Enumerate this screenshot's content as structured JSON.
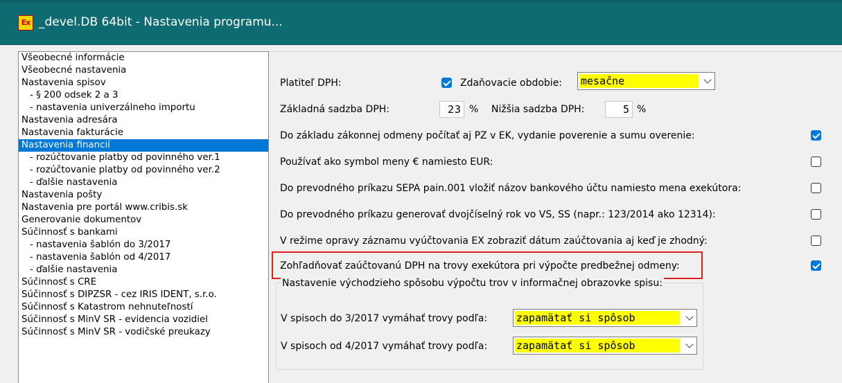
{
  "window": {
    "title": "_devel.DB 64bit - Nastavenia programu...",
    "icon": "app-ex-icon",
    "icon_text": "Ex"
  },
  "sidebar": {
    "items": [
      {
        "label": "Všeobecné informácie",
        "sub": false
      },
      {
        "label": "Všeobecné nastavenia",
        "sub": false
      },
      {
        "label": "Nastavenia spisov",
        "sub": false
      },
      {
        "label": "- § 200 odsek 2 a 3",
        "sub": true
      },
      {
        "label": "- nastavenia univerzálneho importu",
        "sub": true
      },
      {
        "label": "Nastavenia adresára",
        "sub": false
      },
      {
        "label": "Nastavenia fakturácie",
        "sub": false
      },
      {
        "label": "Nastavenia financií",
        "sub": false,
        "selected": true
      },
      {
        "label": "- rozúčtovanie platby od povinného ver.1",
        "sub": true
      },
      {
        "label": "- rozúčtovanie platby od povinného ver.2",
        "sub": true
      },
      {
        "label": "- ďalšie nastavenia",
        "sub": true
      },
      {
        "label": "Nastavenia pošty",
        "sub": false
      },
      {
        "label": "Nastavenia pre portál www.cribis.sk",
        "sub": false
      },
      {
        "label": "Generovanie dokumentov",
        "sub": false
      },
      {
        "label": "Súčinnosť s bankami",
        "sub": false
      },
      {
        "label": "- nastavenia šablón do 3/2017",
        "sub": true
      },
      {
        "label": "- nastavenia šablón od 4/2017",
        "sub": true
      },
      {
        "label": "- ďalšie nastavenia",
        "sub": true
      },
      {
        "label": "Súčinnosť s CRE",
        "sub": false
      },
      {
        "label": "Súčinnosť s DIPZSR - cez IRIS IDENT, s.r.o.",
        "sub": false
      },
      {
        "label": "Súčinnosť s Katastrom nehnuteľností",
        "sub": false
      },
      {
        "label": "Súčinnosť s MinV SR - evidencia vozidiel",
        "sub": false
      },
      {
        "label": "Súčinnosť s MinV SR - vodičské preukazy",
        "sub": false
      }
    ]
  },
  "settings": {
    "platitel_dph_label": "Platiteľ DPH:",
    "platitel_dph_checked": true,
    "zdanovacie_label": "Zdaňovacie obdobie:",
    "zdanovacie_value": "mesačne",
    "zakladna_label": "Základná sadzba DPH:",
    "zakladna_value": "23",
    "percent_symbol": "%",
    "nizsia_label": "Nižšia sadzba DPH:",
    "nizsia_value": "5",
    "rows": [
      {
        "label": "Do základu zákonnej odmeny počítať aj PZ v EK, vydanie poverenie a sumu overenie:",
        "checked": true
      },
      {
        "label": "Používať ako symbol meny € namiesto EUR:",
        "checked": false
      },
      {
        "label": "Do prevodného príkazu SEPA pain.001 vložiť názov bankového účtu namiesto mena exekútora:",
        "checked": false
      },
      {
        "label": "Do prevodného príkazu generovať dvojčíselný rok vo VS, SS (napr.: 123/2014 ako 12314):",
        "checked": false
      },
      {
        "label": "V režime opravy záznamu vyúčtovania EX zobraziť dátum zaúčtovania aj keď je zhodný:",
        "checked": false
      },
      {
        "label": "Zohľadňovať zaúčtovanú DPH na trovy exekútora pri výpočte predbežnej odmeny:",
        "checked": true
      }
    ]
  },
  "group": {
    "caption": "Nastavenie východzieho spôsobu výpočtu trov v informačnej obrazovke spisu:",
    "row1_label": "V spisoch do 3/2017 vymáhať trovy podľa:",
    "row1_value": "zapamätať si spôsob",
    "row2_label": "V spisoch od 4/2017 vymáhať trovy podľa:",
    "row2_value": "zapamätať si spôsob"
  },
  "colors": {
    "titlebar": "#0f6b72",
    "selection": "#0078d7",
    "combo_highlight": "#ffff00",
    "callout_border": "#e0201a"
  }
}
